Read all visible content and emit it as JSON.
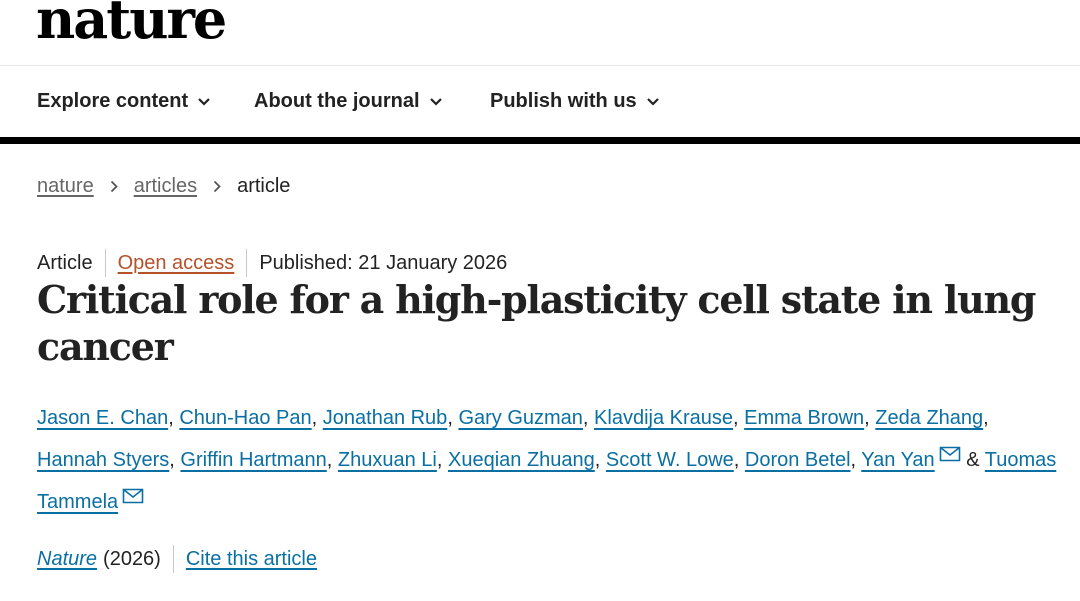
{
  "site": {
    "logo": "nature"
  },
  "nav": [
    {
      "label": "Explore content"
    },
    {
      "label": "About the journal"
    },
    {
      "label": "Publish with us"
    }
  ],
  "breadcrumb": [
    {
      "label": "nature"
    },
    {
      "label": "articles"
    },
    {
      "label": "article"
    }
  ],
  "article": {
    "type": "Article",
    "access": "Open access",
    "published": "Published: 21 January 2026",
    "title": "Critical role for a high-plasticity cell state in lung cancer",
    "authors": [
      "Jason E. Chan",
      "Chun-Hao Pan",
      "Jonathan Rub",
      "Gary Guzman",
      "Klavdija Krause",
      "Emma Brown",
      "Zeda Zhang",
      "Hannah Styers",
      "Griffin Hartmann",
      "Zhuxuan Li",
      "Xueqian Zhuang",
      "Scott W. Lowe",
      "Doron Betel",
      "Yan Yan",
      "Tuomas Tammela"
    ],
    "author_separator": ",",
    "conjunction": "&",
    "journal": "Nature",
    "year": "(2026)",
    "cite_label": "Cite this article"
  },
  "colors": {
    "link": "#0a6fa3",
    "open_access": "#b5522a",
    "text": "#222222",
    "rule": "#000000"
  },
  "icons": {
    "nav_chevron": "chevron-down-icon",
    "breadcrumb_separator": "chevron-right-icon",
    "contact": "mail-icon"
  }
}
